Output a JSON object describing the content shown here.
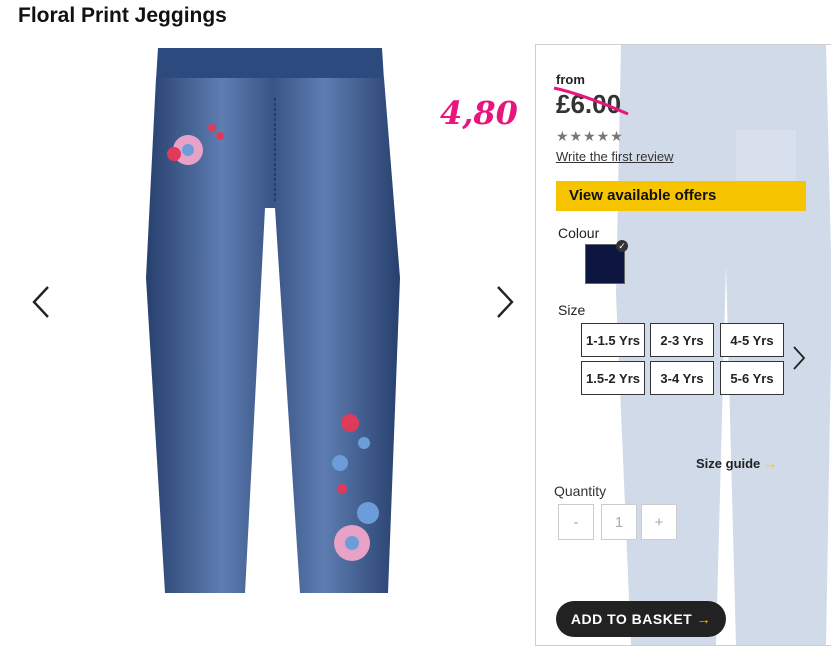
{
  "product": {
    "title": "Floral Print Jeggings"
  },
  "pricing": {
    "from_label": "from",
    "old_price": "£6.00",
    "handwritten_price": "4,80",
    "handwritten_color": "#e8167c"
  },
  "reviews": {
    "stars": "★★★★★",
    "rating": 0,
    "link_text": "Write the first review"
  },
  "offers": {
    "button_label": "View available offers",
    "color": "#f7c400"
  },
  "colour": {
    "label": "Colour",
    "selected_swatch": "#0b1540",
    "check_icon": "✓"
  },
  "size": {
    "label": "Size",
    "options": [
      "1-1.5 Yrs",
      "2-3 Yrs",
      "4-5 Yrs",
      "1.5-2 Yrs",
      "3-4 Yrs",
      "5-6 Yrs"
    ],
    "guide_label": "Size guide",
    "guide_arrow": "→"
  },
  "quantity": {
    "label": "Quantity",
    "minus": "-",
    "value": "1",
    "plus": "+"
  },
  "basket": {
    "label": "ADD TO BASKET",
    "arrow": "→"
  },
  "icons": {
    "prev": "chevron-left-icon",
    "next": "chevron-right-icon"
  }
}
